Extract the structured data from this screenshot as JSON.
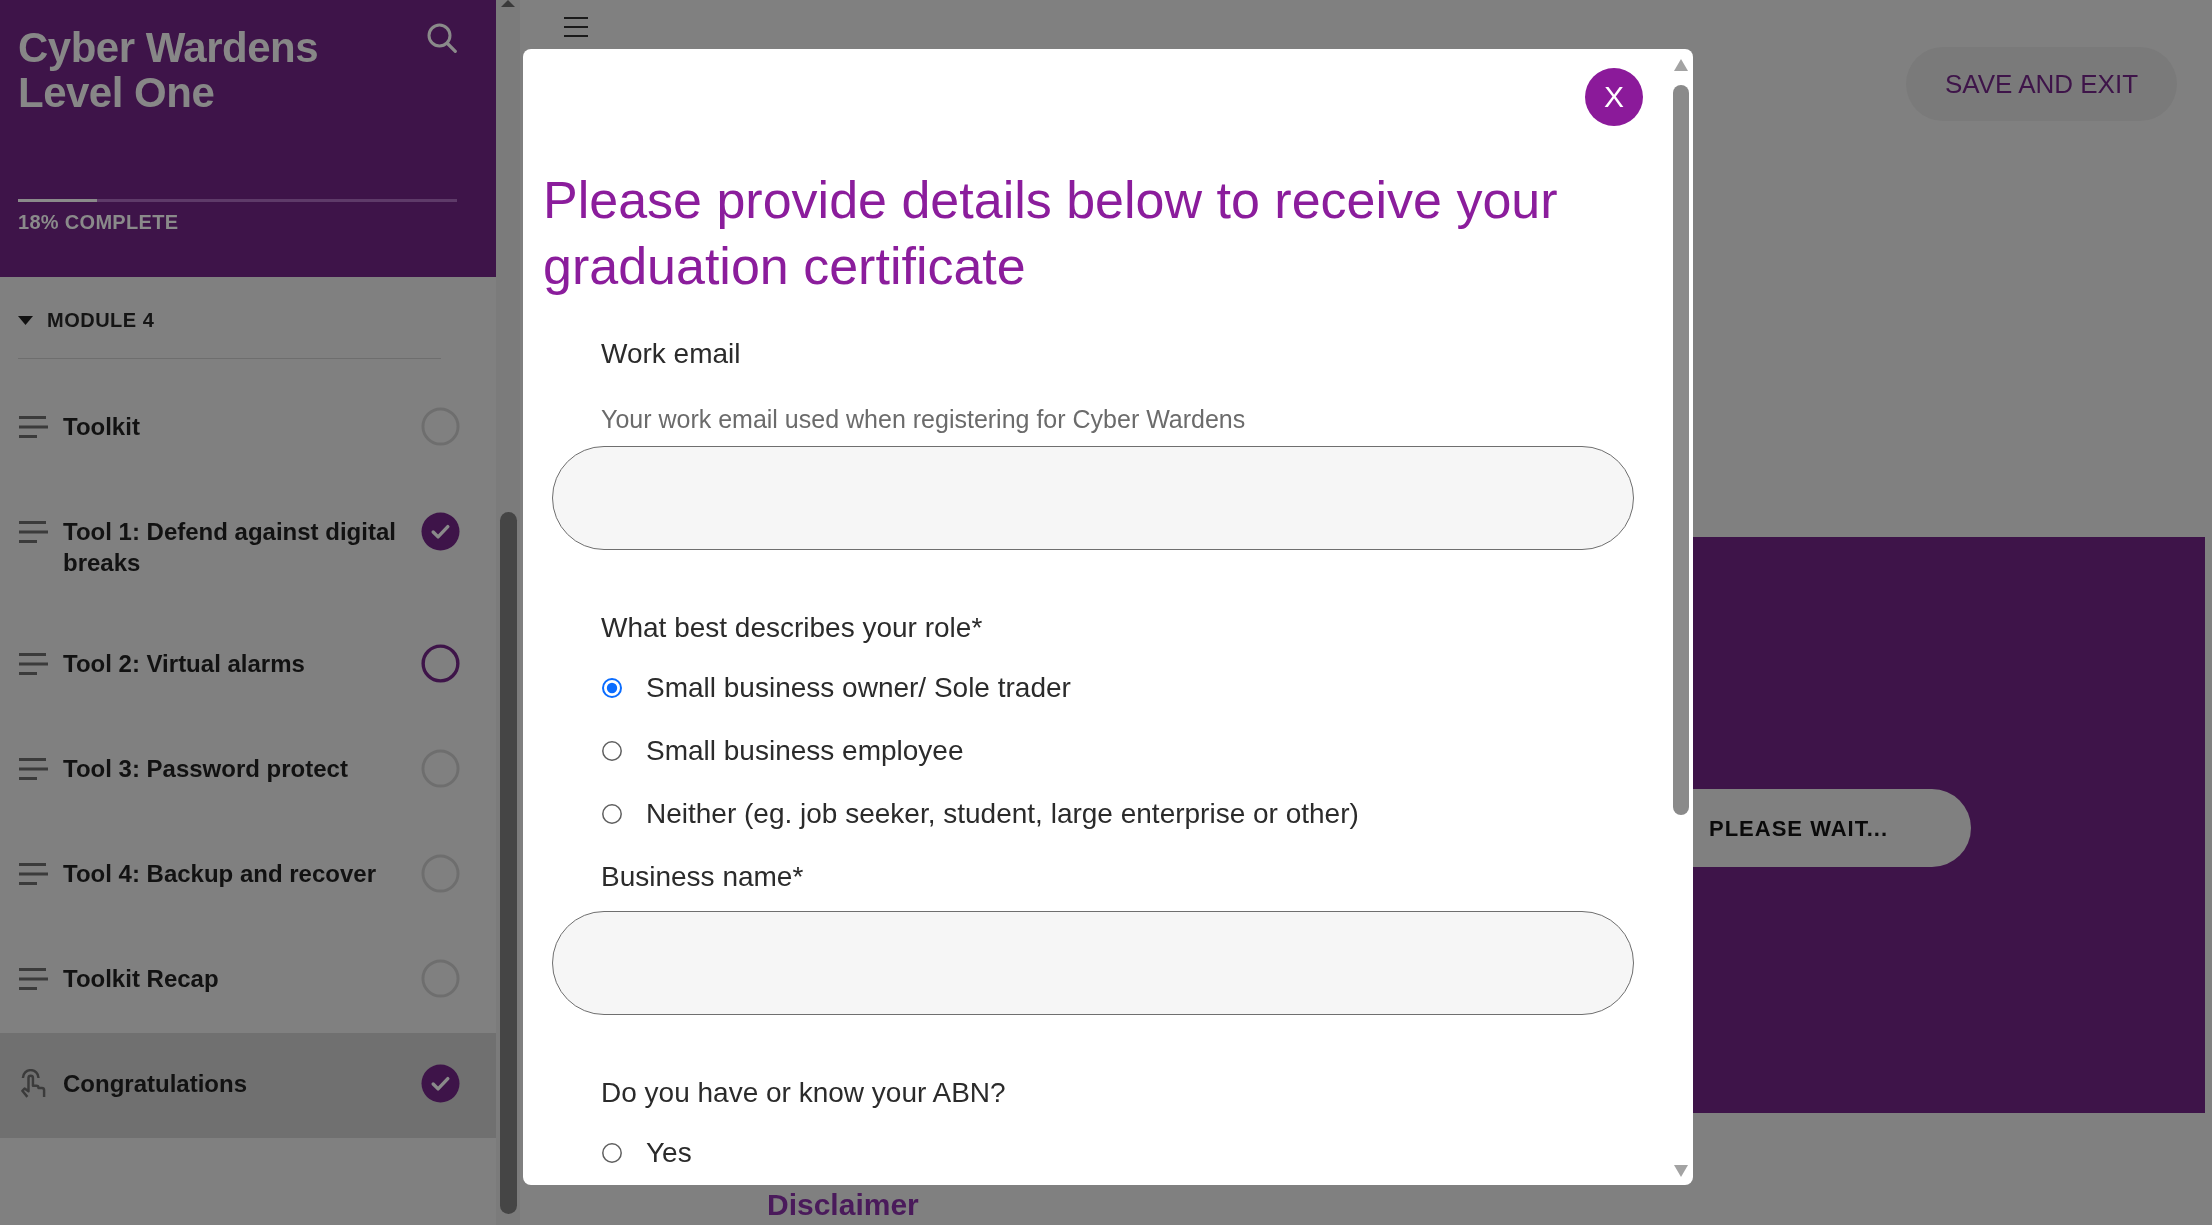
{
  "sidebar": {
    "title": "Cyber Wardens Level One",
    "progress": {
      "level": 0.18,
      "label": "18% COMPLETE"
    },
    "module": {
      "label": "MODULE 4",
      "expanded": true
    },
    "items": [
      {
        "label": "Toolkit",
        "kind": "lesson",
        "complete": false,
        "in_progress": false,
        "selected": false
      },
      {
        "label": "Tool 1: Defend against digital breaks",
        "kind": "lesson",
        "complete": true,
        "in_progress": false,
        "selected": false
      },
      {
        "label": "Tool 2: Virtual alarms",
        "kind": "lesson",
        "complete": false,
        "in_progress": true,
        "selected": false
      },
      {
        "label": "Tool 3: Password protect",
        "kind": "lesson",
        "complete": false,
        "in_progress": false,
        "selected": false
      },
      {
        "label": "Tool 4: Backup and recover",
        "kind": "lesson",
        "complete": false,
        "in_progress": false,
        "selected": false
      },
      {
        "label": "Toolkit Recap",
        "kind": "lesson",
        "complete": false,
        "in_progress": false,
        "selected": false
      },
      {
        "label": "Congratulations",
        "kind": "interactive",
        "complete": true,
        "in_progress": false,
        "selected": true
      }
    ]
  },
  "header": {
    "save_button": "SAVE AND EXIT"
  },
  "content": {
    "wait_button": "PLEASE WAIT...",
    "footer_link": "Disclaimer"
  },
  "modal": {
    "close_label": "X",
    "heading": "Please provide details below to receive your graduation certificate",
    "fields": [
      {
        "kind": "text",
        "label": "Work email",
        "help": "Your work email used when registering for Cyber Wardens"
      },
      {
        "kind": "radio",
        "label": "What best describes your role*",
        "options": [
          {
            "label": "Small business owner/ Sole trader",
            "selected": true
          },
          {
            "label": "Small business employee",
            "selected": false
          },
          {
            "label": "Neither (eg. job seeker, student, large enterprise or other)",
            "selected": false
          }
        ]
      },
      {
        "kind": "text",
        "label": "Business name*"
      },
      {
        "kind": "radio",
        "label": "Do you have or know your ABN?",
        "options": [
          {
            "label": "Yes",
            "selected": false
          }
        ]
      }
    ]
  }
}
